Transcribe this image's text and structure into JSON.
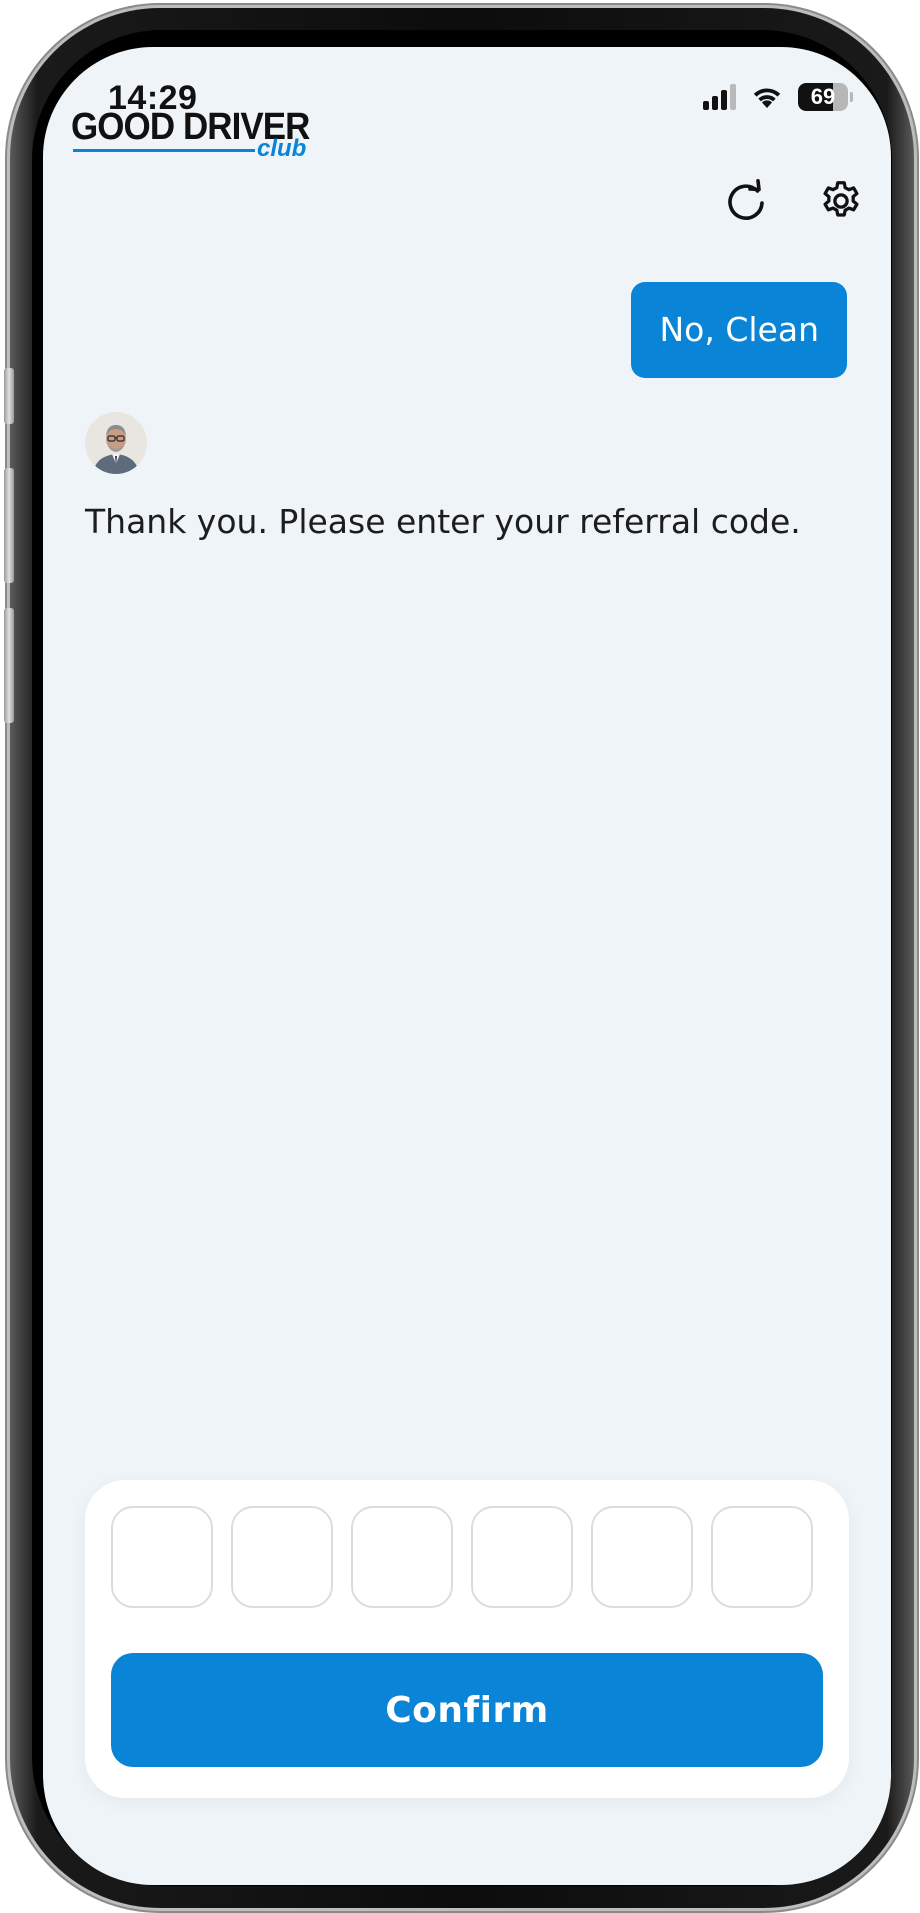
{
  "status_bar": {
    "time": "14:29",
    "battery_label": "69",
    "battery_level_percent": 69,
    "signal_bars_filled": 3,
    "icons": [
      "cellular-signal-icon",
      "wifi-icon",
      "battery-icon"
    ]
  },
  "header": {
    "logo_main": "GOOD DRIVER",
    "logo_sub": "club",
    "icons": [
      "refresh-icon",
      "gear-icon"
    ]
  },
  "chat": {
    "user_reply": "No, Clean",
    "bot_message": "Thank you. Please enter your referral code."
  },
  "referral": {
    "code_length": 6,
    "code_values": [
      "",
      "",
      "",
      "",
      "",
      ""
    ],
    "confirm_label": "Confirm"
  },
  "colors": {
    "brand_blue": "#0a84d6",
    "screen_background": "#eef4f8",
    "card_background": "#ffffff"
  }
}
